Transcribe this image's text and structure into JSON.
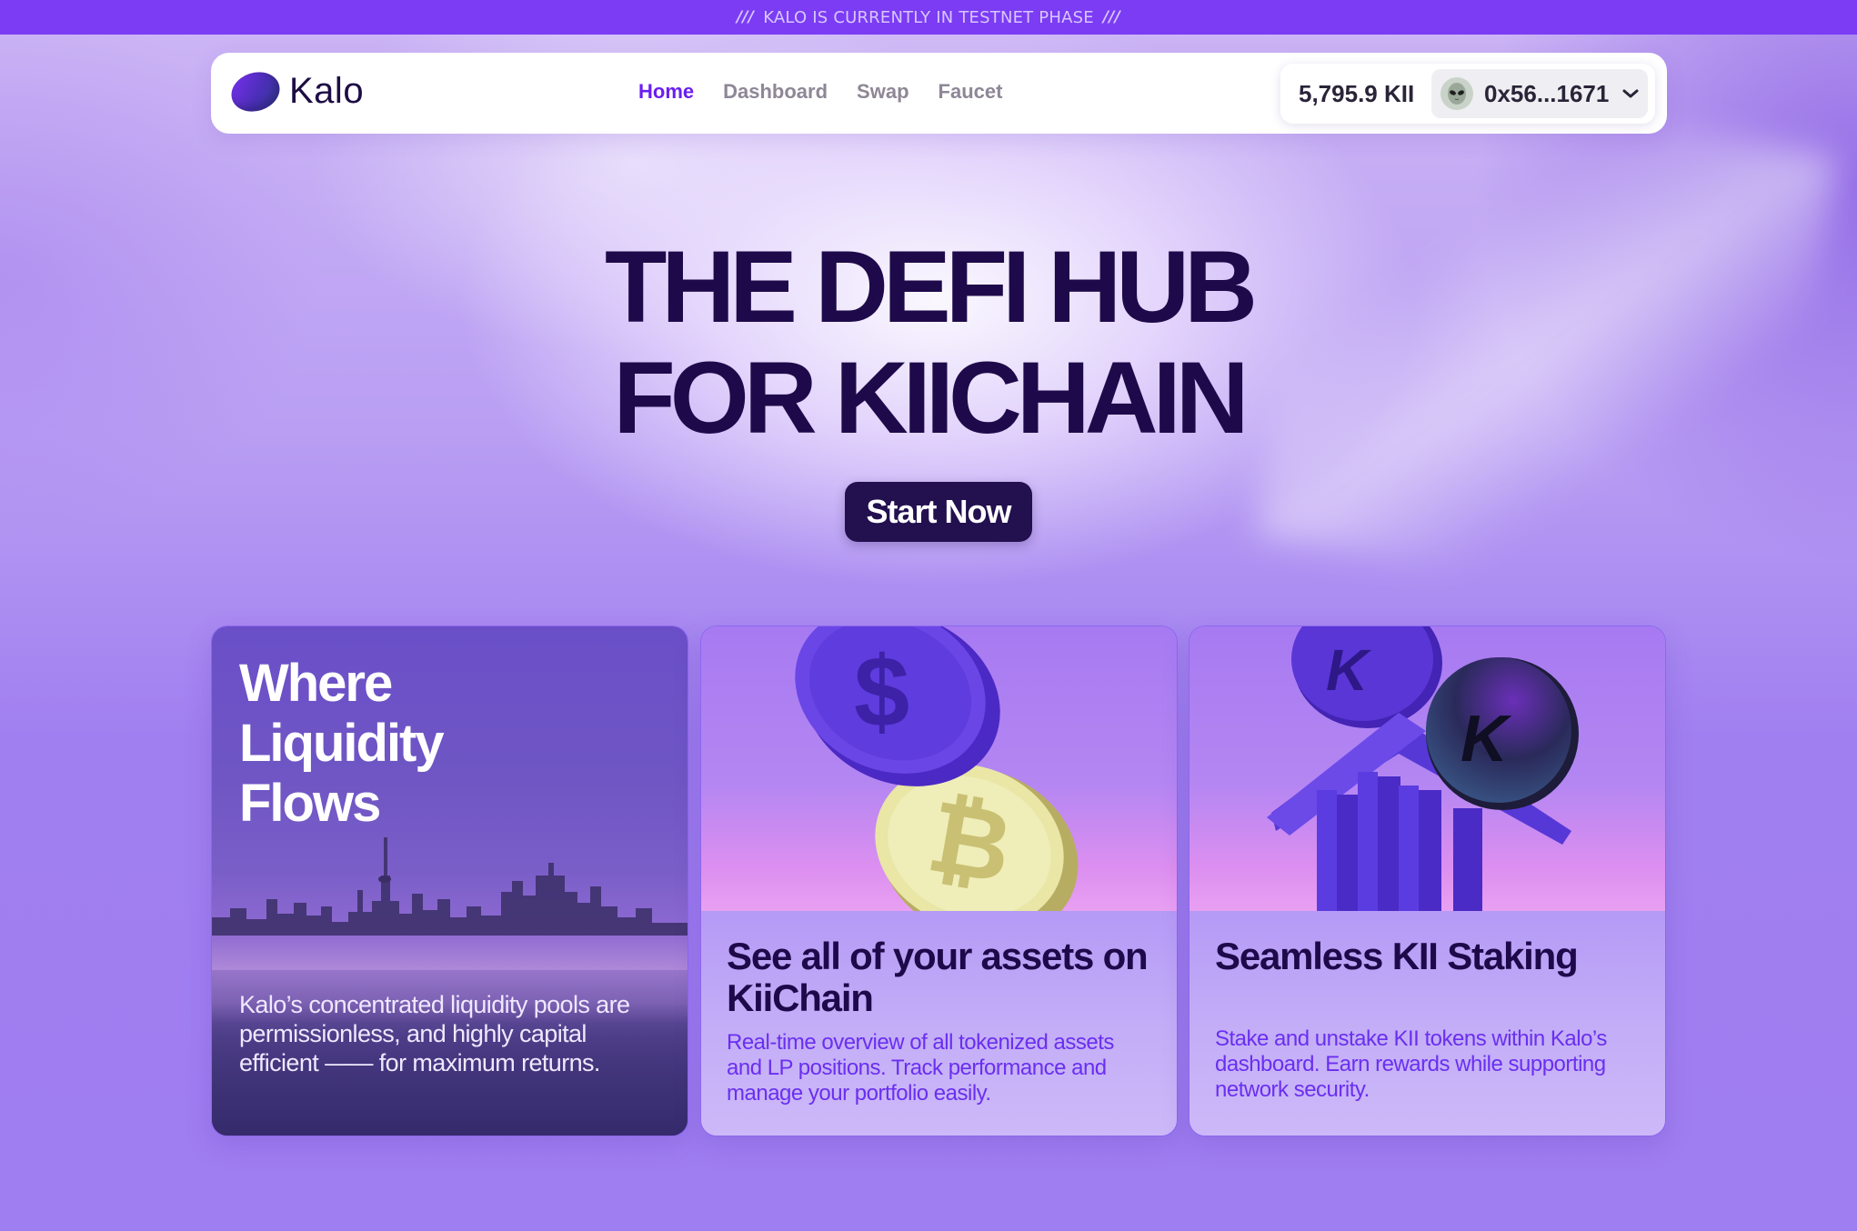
{
  "banner": {
    "text": "KALO IS CURRENTLY IN TESTNET PHASE",
    "left_mark": "///",
    "right_mark": "///"
  },
  "nav": {
    "logo_text": "Kalo",
    "links": [
      {
        "label": "Home",
        "active": true
      },
      {
        "label": "Dashboard",
        "active": false
      },
      {
        "label": "Swap",
        "active": false
      },
      {
        "label": "Faucet",
        "active": false
      }
    ],
    "balance": "5,795.9 KII",
    "address": "0x56...1671",
    "avatar_icon": "alien-icon",
    "dropdown_icon": "chevron-down-icon"
  },
  "hero": {
    "title_line1": "THE DEFI HUB",
    "title_line2": "FOR KIICHAIN",
    "cta": "Start Now"
  },
  "cards": [
    {
      "title_lines": [
        "Where",
        "Liquidity",
        "Flows"
      ],
      "description": "Kalo’s concentrated liquidity pools are permissionless, and highly capital efficient —— for maximum returns."
    },
    {
      "title": "See all of your assets on KiiChain",
      "description": "Real-time overview of all tokenized assets and LP positions. Track performance and manage your portfolio easily."
    },
    {
      "title": "Seamless KII Staking",
      "description": "Stake and unstake KII tokens within Kalo’s dashboard. Earn rewards while supporting network security."
    }
  ],
  "colors": {
    "banner": "#7b3cf4",
    "accent": "#6a1ef0",
    "hero_text": "#1e0a4a",
    "cta_bg": "#22104f"
  }
}
